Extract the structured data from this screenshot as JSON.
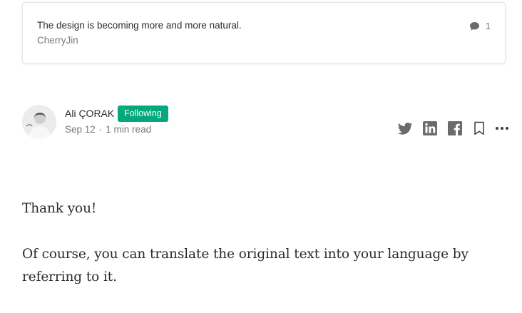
{
  "response_card": {
    "text": "The design is becoming more and more natural.",
    "author": "CherryJin",
    "response_count": "1"
  },
  "author": {
    "name": "Ali ÇORAK",
    "follow_label": "Following",
    "date": "Sep 12",
    "separator": "·",
    "read_time": "1 min read"
  },
  "share": {
    "icons": [
      "twitter-icon",
      "linkedin-icon",
      "facebook-icon",
      "bookmark-icon",
      "more-icon"
    ]
  },
  "article": {
    "paragraphs": [
      "Thank you!",
      "Of course, you can translate the original text into your language by referring to it."
    ]
  },
  "colors": {
    "follow_green": "#03a87c",
    "icon_gray": "#6b6b6b",
    "text_dark": "rgba(0,0,0,0.84)",
    "text_muted": "rgba(0,0,0,0.54)"
  }
}
